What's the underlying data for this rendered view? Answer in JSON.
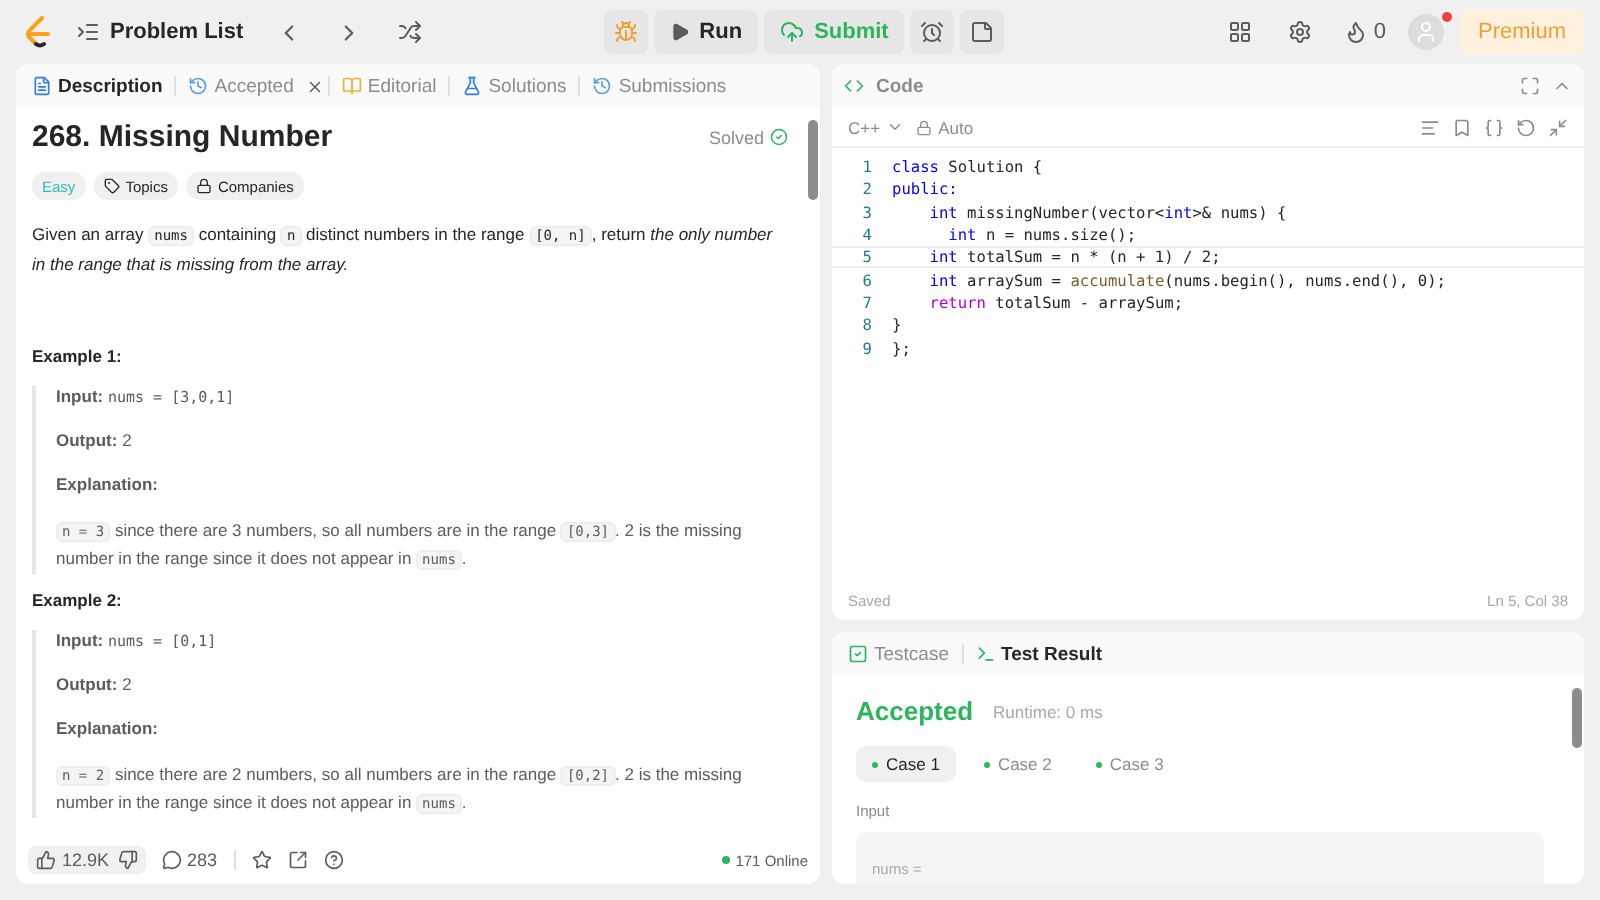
{
  "top_bar": {
    "problem_list": "Problem List",
    "run": "Run",
    "submit": "Submit",
    "streak": "0",
    "premium": "Premium"
  },
  "description_tabs": [
    {
      "label": "Description",
      "selected": true,
      "closable": false
    },
    {
      "label": "Accepted",
      "selected": false,
      "closable": true
    },
    {
      "label": "Editorial",
      "selected": false,
      "closable": false
    },
    {
      "label": "Solutions",
      "selected": false,
      "closable": false
    },
    {
      "label": "Submissions",
      "selected": false,
      "closable": false
    }
  ],
  "problem": {
    "title": "268. Missing Number",
    "status": "Solved",
    "difficulty": "Easy",
    "tags": [
      "Topics",
      "Companies"
    ],
    "statement": [
      {
        "kind": "text",
        "text": "Given an array "
      },
      {
        "kind": "code",
        "text": "nums"
      },
      {
        "kind": "text",
        "text": " containing "
      },
      {
        "kind": "code",
        "text": "n"
      },
      {
        "kind": "text",
        "text": " distinct numbers in the range "
      },
      {
        "kind": "code",
        "text": "[0, n]"
      },
      {
        "kind": "text",
        "text": ", return "
      },
      {
        "kind": "italic",
        "text": "the only number in the range that is missing from the array."
      }
    ],
    "examples": [
      {
        "title": "Example 1:",
        "input_label": "Input:",
        "input": "nums = [3,0,1]",
        "output_label": "Output:",
        "output": "2",
        "explanation_label": "Explanation:",
        "explanation": [
          {
            "kind": "code",
            "text": "n = 3"
          },
          {
            "kind": "text",
            "text": " since there are 3 numbers, so all numbers are in the range "
          },
          {
            "kind": "code",
            "text": "[0,3]"
          },
          {
            "kind": "text",
            "text": ". 2 is the missing number in the range since it does not appear in "
          },
          {
            "kind": "code",
            "text": "nums"
          },
          {
            "kind": "text",
            "text": "."
          }
        ]
      },
      {
        "title": "Example 2:",
        "input_label": "Input:",
        "input": "nums = [0,1]",
        "output_label": "Output:",
        "output": "2",
        "explanation_label": "Explanation:",
        "explanation": [
          {
            "kind": "code",
            "text": "n = 2"
          },
          {
            "kind": "text",
            "text": " since there are 2 numbers, so all numbers are in the range "
          },
          {
            "kind": "code",
            "text": "[0,2]"
          },
          {
            "kind": "text",
            "text": ". 2 is the missing number in the range since it does not appear in "
          },
          {
            "kind": "code",
            "text": "nums"
          },
          {
            "kind": "text",
            "text": "."
          }
        ]
      }
    ]
  },
  "footer": {
    "likes": "12.9K",
    "comments": "283",
    "online": "171 Online"
  },
  "code_panel": {
    "title": "Code",
    "language": "C++",
    "mode": "Auto",
    "status": "Saved",
    "cursor": "Ln 5, Col 38",
    "lines": [
      {
        "number": "1",
        "tokens": [
          {
            "kind": "keyword",
            "text": "class"
          },
          {
            "kind": "plain",
            "text": " Solution {"
          }
        ]
      },
      {
        "number": "2",
        "tokens": [
          {
            "kind": "keyword",
            "text": "public:"
          }
        ]
      },
      {
        "number": "3",
        "tokens": [
          {
            "kind": "keyword",
            "text": "    int"
          },
          {
            "kind": "plain",
            "text": " missingNumber(vector<"
          },
          {
            "kind": "keyword",
            "text": "int"
          },
          {
            "kind": "plain",
            "text": ">& nums) {"
          }
        ]
      },
      {
        "number": "4",
        "tokens": [
          {
            "kind": "keyword",
            "text": "      int"
          },
          {
            "kind": "plain",
            "text": " n = nums.size();"
          }
        ]
      },
      {
        "number": "5",
        "tokens": [
          {
            "kind": "keyword",
            "text": "    int"
          },
          {
            "kind": "plain",
            "text": " totalSum = n * (n + 1) / 2;"
          }
        ]
      },
      {
        "number": "6",
        "tokens": [
          {
            "kind": "keyword",
            "text": "    int"
          },
          {
            "kind": "plain",
            "text": " arraySum = "
          },
          {
            "kind": "function",
            "text": "accumulate"
          },
          {
            "kind": "plain",
            "text": "(nums.begin(), nums.end(), 0);"
          }
        ]
      },
      {
        "number": "7",
        "tokens": [
          {
            "kind": "control",
            "text": "    return"
          },
          {
            "kind": "plain",
            "text": " totalSum - arraySum;"
          }
        ]
      },
      {
        "number": "8",
        "tokens": [
          {
            "kind": "plain",
            "text": "}"
          }
        ]
      },
      {
        "number": "9",
        "tokens": [
          {
            "kind": "plain",
            "text": "};"
          }
        ]
      }
    ]
  },
  "result_tabs": [
    {
      "label": "Testcase",
      "selected": false
    },
    {
      "label": "Test Result",
      "selected": true
    }
  ],
  "result": {
    "verdict": "Accepted",
    "runtime": "Runtime: 0 ms",
    "cases": [
      {
        "label": "Case 1",
        "selected": true
      },
      {
        "label": "Case 2",
        "selected": false
      },
      {
        "label": "Case 3",
        "selected": false
      }
    ],
    "input_label": "Input",
    "input_name": "nums ="
  }
}
